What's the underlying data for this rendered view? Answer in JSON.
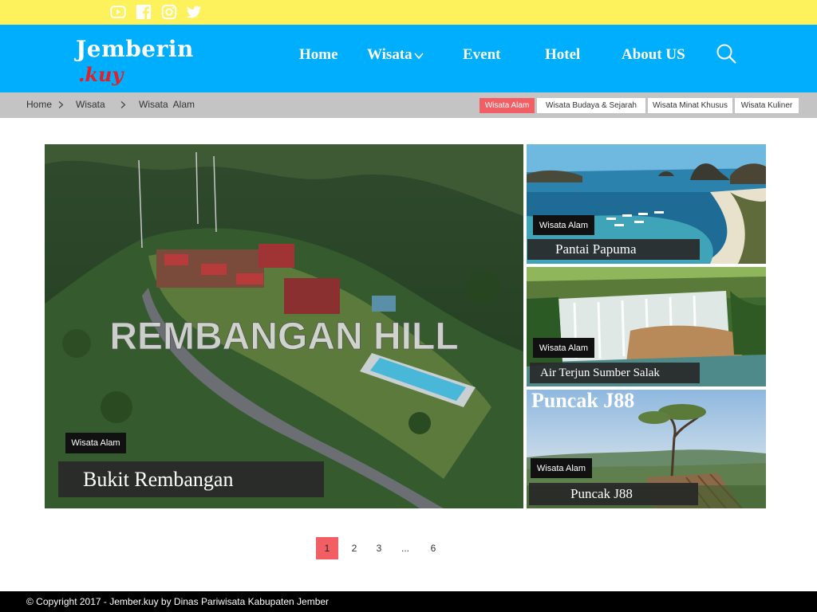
{
  "social": {
    "icons": [
      "youtube-icon",
      "facebook-icon",
      "instagram-icon",
      "twitter-icon"
    ],
    "bar_color": "#fdf15c"
  },
  "header": {
    "logo_main": "Jemberin",
    "logo_sub": ".kuy",
    "bg_color": "#00aefe",
    "nav": [
      "Home",
      "Wisata",
      "Event",
      "Hotel",
      "About US"
    ]
  },
  "breadcrumb": {
    "items": [
      "Home",
      "Wisata",
      "Wisata  Alam"
    ]
  },
  "filters": {
    "tabs": [
      "Wisata Alam",
      "Wisata Budaya & Sejarah",
      "Wisata Minat Khusus",
      "Wisata Kuliner"
    ],
    "active_color": "#f15e63"
  },
  "featured": {
    "image_text": "REMBANGAN HILL",
    "category": "Wisata Alam",
    "title": "Bukit Rembangan"
  },
  "side_cards": [
    {
      "category": "Wisata Alam",
      "title": "Pantai Papuma"
    },
    {
      "category": "Wisata Alam",
      "title": "Air Terjun Sumber Salak"
    },
    {
      "category": "Wisata Alam",
      "title": "Puncak J88",
      "image_text": "Puncak J88"
    }
  ],
  "pagination": [
    "1",
    "2",
    "3",
    "...",
    "6"
  ],
  "footer": {
    "copyright": "© Copyright 2017 - Jember.kuy by Dinas Pariwisata Kabupaten Jember"
  }
}
